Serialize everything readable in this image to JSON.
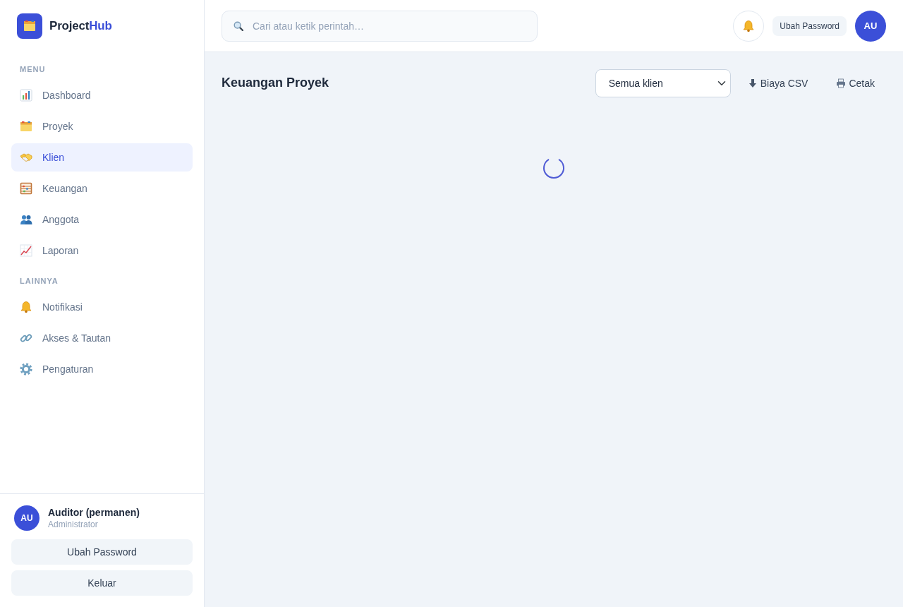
{
  "sidebar": {
    "brand": {
      "name": "Project",
      "accent": "Hub"
    },
    "sections": [
      {
        "heading": "MENU",
        "items": [
          {
            "label": "Dashboard",
            "selected": false
          },
          {
            "label": "Proyek",
            "selected": false
          },
          {
            "label": "Klien",
            "selected": true
          },
          {
            "label": "Keuangan",
            "selected": false
          },
          {
            "label": "Anggota",
            "selected": false
          },
          {
            "label": "Laporan",
            "selected": false
          }
        ]
      },
      {
        "heading": "LAINNYA",
        "items": [
          {
            "label": "Notifikasi",
            "selected": false
          },
          {
            "label": "Akses & Tautan",
            "selected": false
          },
          {
            "label": "Pengaturan",
            "selected": false
          }
        ]
      }
    ],
    "user": {
      "initials": "AU",
      "name": "Auditor (permanen)",
      "role": "Administrator"
    },
    "buttons": [
      "Ubah Password",
      "Keluar"
    ]
  },
  "topbar": {
    "search": {
      "placeholder": "Cari atau ketik perintah…"
    },
    "password_button": "Ubah Password",
    "avatar": "AU"
  },
  "page": {
    "title": "Keuangan Proyek",
    "client_filter": {
      "value": "Semua klien"
    },
    "actions": [
      "Biaya CSV",
      "Cetak"
    ],
    "loading": true
  }
}
